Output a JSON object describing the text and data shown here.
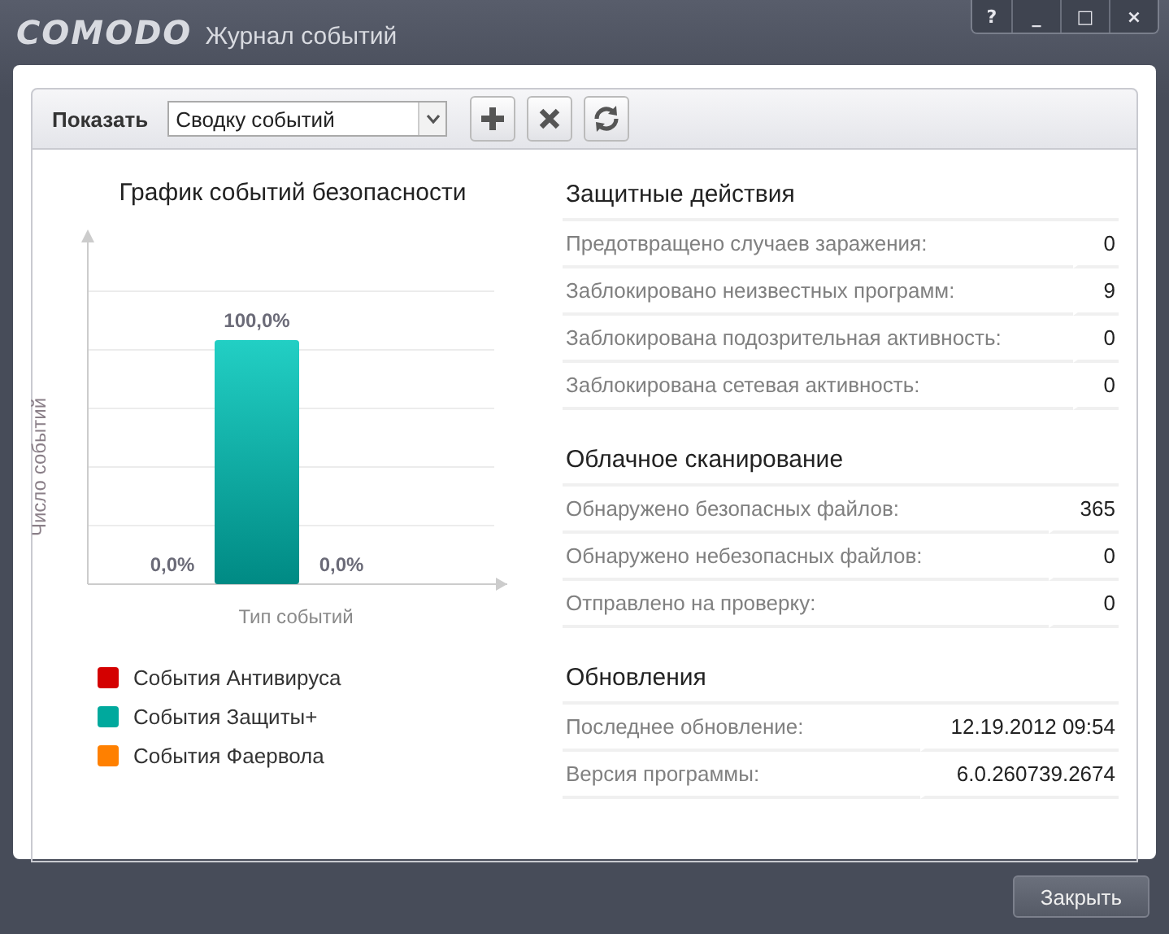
{
  "window": {
    "logo": "COMODO",
    "title": "Журнал событий",
    "controls": [
      "?",
      "_",
      "□",
      "×"
    ]
  },
  "toolbar": {
    "label": "Показать",
    "dropdown": {
      "value": "Сводку событий"
    }
  },
  "chart": {
    "title": "График событий безопасности",
    "xlabel": "Тип событий",
    "ylabel": "Число событий",
    "bars": [
      {
        "label": "0,0%"
      },
      {
        "label": "100,0%",
        "level": 1
      },
      {
        "label": "0,0%"
      }
    ],
    "legend": [
      {
        "label": "События Антивируса",
        "color": "#d40000"
      },
      {
        "label": "События Защиты+",
        "color": "#00a99d"
      },
      {
        "label": "События Фаервола",
        "color": "#ff8000"
      }
    ]
  },
  "sections": [
    {
      "title": "Защитные действия",
      "rows": [
        {
          "label": "Предотвращено случаев заражения:",
          "value": "0"
        },
        {
          "label": "Заблокировано неизвестных программ:",
          "value": "9"
        },
        {
          "label": "Заблокирована подозрительная активность:",
          "value": "0"
        },
        {
          "label": "Заблокирована сетевая активность:",
          "value": "0"
        }
      ]
    },
    {
      "title": "Облачное сканирование",
      "rows": [
        {
          "label": "Обнаружено безопасных файлов:",
          "value": "365"
        },
        {
          "label": "Обнаружено небезопасных файлов:",
          "value": "0"
        },
        {
          "label": "Отправлено на проверку:",
          "value": "0"
        }
      ]
    },
    {
      "title": "Обновления",
      "rows": [
        {
          "label": "Последнее обновление:",
          "value": "12.19.2012 09:54"
        },
        {
          "label": "Версия программы:",
          "value": "6.0.260739.2674"
        }
      ]
    }
  ],
  "footer": {
    "close_button": "Закрыть"
  }
}
